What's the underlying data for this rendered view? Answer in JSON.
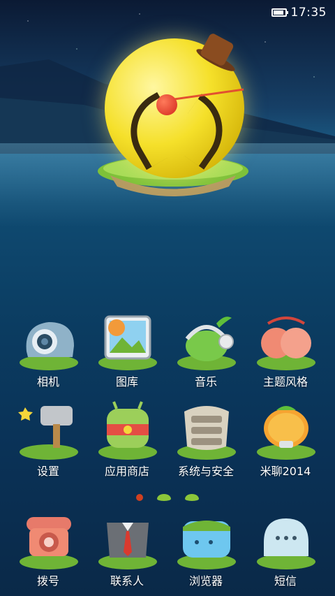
{
  "status_bar": {
    "time": "17:35",
    "battery_level": 0.9
  },
  "home": {
    "apps_row1": [
      {
        "label": "相机",
        "icon": "camera-icon"
      },
      {
        "label": "图库",
        "icon": "gallery-icon"
      },
      {
        "label": "音乐",
        "icon": "music-icon"
      },
      {
        "label": "主题风格",
        "icon": "theme-icon"
      }
    ],
    "apps_row2": [
      {
        "label": "设置",
        "icon": "settings-icon"
      },
      {
        "label": "应用商店",
        "icon": "app-store-icon"
      },
      {
        "label": "系统与安全",
        "icon": "security-icon"
      },
      {
        "label": "米聊2014",
        "icon": "miliao-icon"
      }
    ],
    "page_indicator": {
      "pages": 3,
      "active": 1
    }
  },
  "dock": [
    {
      "label": "拨号",
      "icon": "phone-icon"
    },
    {
      "label": "联系人",
      "icon": "contacts-icon"
    },
    {
      "label": "浏览器",
      "icon": "browser-icon"
    },
    {
      "label": "短信",
      "icon": "messages-icon"
    }
  ],
  "colors": {
    "label_text": "#ffffff",
    "grass": "#7ec23a"
  }
}
